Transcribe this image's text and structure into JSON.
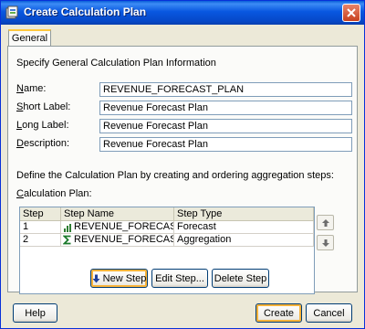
{
  "window": {
    "title": "Create Calculation Plan"
  },
  "tabs": [
    {
      "label": "General"
    }
  ],
  "general": {
    "section_title": "Specify General Calculation Plan Information",
    "name": {
      "label": "Name:",
      "value": "REVENUE_FORECAST_PLAN"
    },
    "short_label": {
      "label": "Short Label:",
      "value": "Revenue Forecast Plan"
    },
    "long_label": {
      "label": "Long Label:",
      "value": "Revenue Forecast Plan"
    },
    "description": {
      "label": "Description:",
      "value": "Revenue Forecast Plan"
    }
  },
  "steps_section": {
    "instruction": "Define the Calculation Plan by creating and ordering aggregation steps:",
    "label": "Calculation Plan:",
    "columns": [
      "Step",
      "Step Name",
      "Step Type"
    ],
    "rows": [
      {
        "step": "1",
        "name": "REVENUE_FORECAST_STE",
        "type": "Forecast",
        "icon": "forecast-chart-icon"
      },
      {
        "step": "2",
        "name": "REVENUE_FORECAST_AS",
        "type": "Aggregation",
        "icon": "sigma-icon"
      }
    ]
  },
  "buttons": {
    "new_step": "New Step",
    "edit_step": "Edit Step...",
    "delete_step": "Delete Step",
    "help": "Help",
    "create": "Create",
    "cancel": "Cancel"
  }
}
